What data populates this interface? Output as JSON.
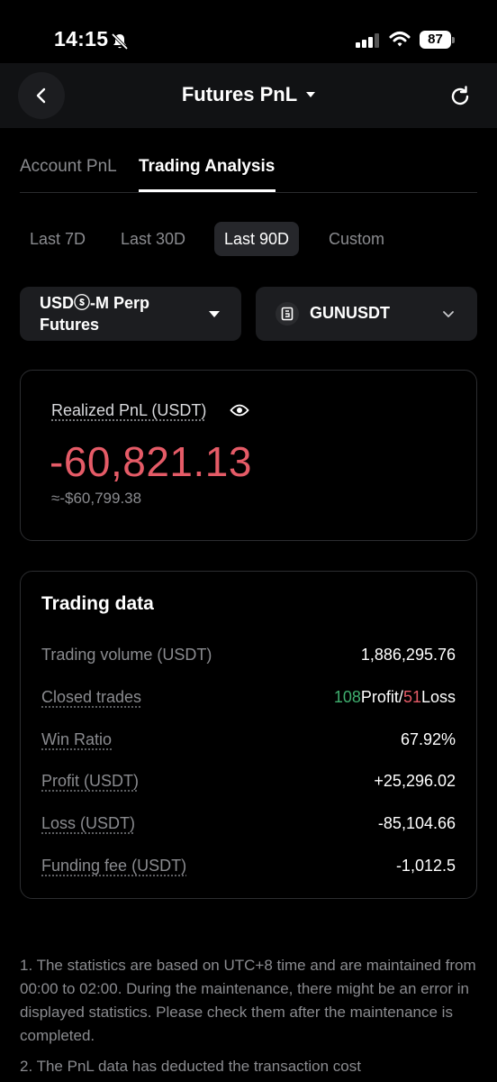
{
  "status_bar": {
    "time": "14:15",
    "battery": "87"
  },
  "header": {
    "title": "Futures PnL"
  },
  "tabs": [
    {
      "label": "Account PnL"
    },
    {
      "label": "Trading Analysis"
    }
  ],
  "periods": [
    {
      "label": "Last 7D"
    },
    {
      "label": "Last 30D"
    },
    {
      "label": "Last 90D"
    },
    {
      "label": "Custom"
    }
  ],
  "selects": {
    "product": {
      "line1": "USDⓢ-M Perp",
      "line2": "Futures"
    },
    "symbol": {
      "label": "GUNUSDT"
    }
  },
  "pnl": {
    "label": "Realized PnL (USDT)",
    "value": "-60,821.13",
    "usd_equiv": "≈-$60,799.38"
  },
  "trading_data": {
    "title": "Trading data",
    "rows": {
      "volume": {
        "label": "Trading volume (USDT)",
        "value": "1,886,295.76"
      },
      "closed_trades": {
        "label": "Closed trades",
        "profit_count": "108",
        "profit_word": "Profit",
        "sep": "/",
        "loss_count": "51",
        "loss_word": "Loss"
      },
      "win_ratio": {
        "label": "Win Ratio",
        "value": "67.92%"
      },
      "profit": {
        "label": "Profit (USDT)",
        "value": "+25,296.02"
      },
      "loss": {
        "label": "Loss (USDT)",
        "value": "-85,104.66"
      },
      "funding": {
        "label": "Funding fee (USDT)",
        "value": "-1,012.5"
      }
    }
  },
  "notes": {
    "note1": "1. The statistics are based on UTC+8 time and are maintained from 00:00 to 02:00. During the maintenance, there might be an error in displayed statistics. Please check them after the maintenance is completed.",
    "note2": "2. The PnL data has deducted the transaction cost"
  },
  "colors": {
    "profit": "#3fae6e",
    "loss": "#e55b67",
    "background": "#000000",
    "card": "#1c1d20"
  }
}
